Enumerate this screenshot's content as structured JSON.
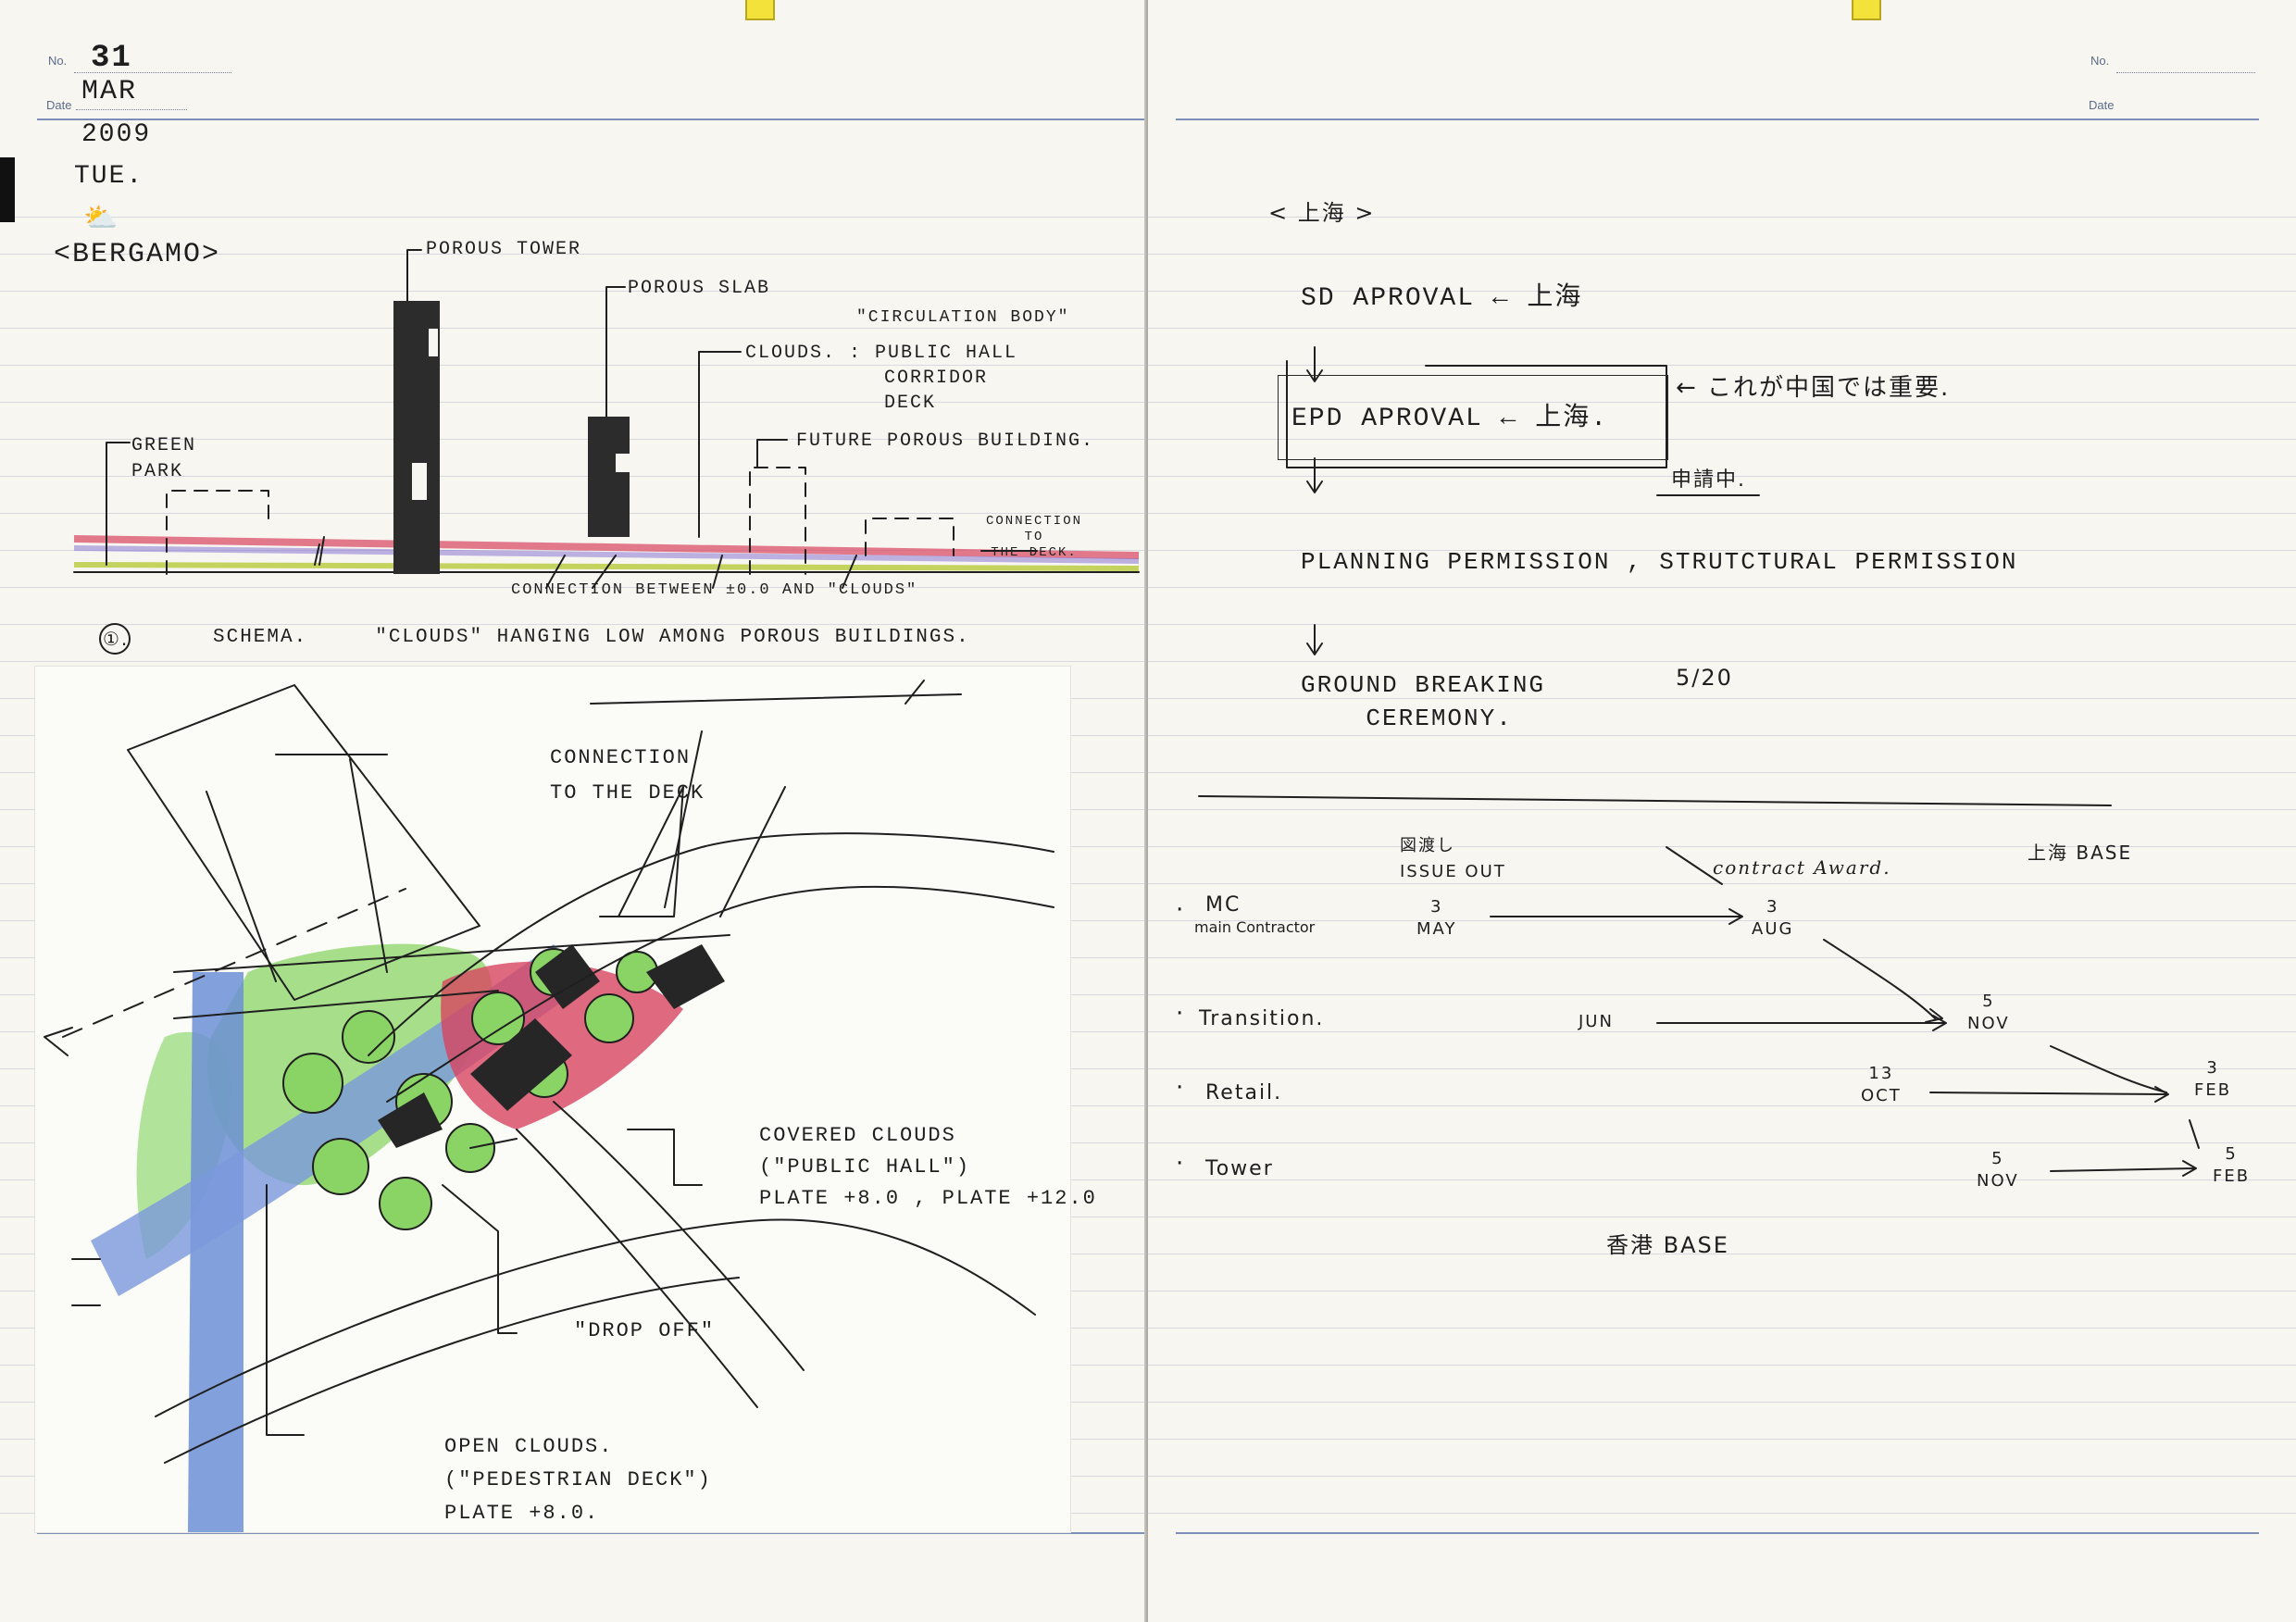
{
  "left_page": {
    "header": {
      "no_label": "No.",
      "date_label": "Date",
      "no_value": "31",
      "date_month": "MAR",
      "date_year": "2009",
      "date_day": "TUE."
    },
    "project_title": "<BERGAMO>",
    "schema": {
      "porous_tower": "POROUS TOWER",
      "porous_slab": "POROUS SLAB",
      "circulation_body": "\"CIRCULATION BODY\"",
      "clouds_label": "CLOUDS. : PUBLIC HALL",
      "clouds_corridor": "CORRIDOR",
      "clouds_deck": "DECK",
      "green_park": "GREEN\nPARK",
      "future_building": "FUTURE POROUS BUILDING.",
      "connection_deck": "CONNECTION\nTO\nTHE DECK.",
      "connection_between": "CONNECTION BETWEEN ±0.0 AND \"CLOUDS\"",
      "caption_number": "①.",
      "caption": "SCHEMA.     \"CLOUDS\" HANGING LOW AMONG POROUS BUILDINGS."
    },
    "plan": {
      "connection_to_deck": "CONNECTION\nTO THE DECK",
      "covered_clouds": "COVERED CLOUDS\n(\"PUBLIC HALL\")\nPLATE +8.0 , PLATE +12.0",
      "drop_off": "\"DROP OFF\"",
      "open_clouds": "OPEN CLOUDS.\n(\"PEDESTRIAN DECK\")\nPLATE +8.0."
    }
  },
  "right_page": {
    "header": {
      "no_label": "No.",
      "date_label": "Date"
    },
    "title": "< 上海 >",
    "sd_approval": "SD APROVAL ← 上海",
    "epd_approval": "EPD APROVAL ← 上海.",
    "note_china": "← これが中国では重要.",
    "under_application": "申請中.",
    "planning": "PLANNING PERMISSION , STRUTCTURAL PERMISSION",
    "ground_breaking": "GROUND BREAKING\n    CEREMONY.",
    "gb_date": "5/20",
    "schedule": {
      "issue_out": "図渡し\nISSUE OUT",
      "contract_award": "contract Award.",
      "shanghai_base": "上海 BASE",
      "hongkong_base": "香港 BASE",
      "rows": [
        {
          "label": "MC",
          "sub": "main Contractor",
          "start": "3\nMAY",
          "end": "3\nAUG"
        },
        {
          "label": "Transition.",
          "sub": "",
          "start": "JUN",
          "end": "5\nNOV"
        },
        {
          "label": "Retail.",
          "sub": "",
          "start": "13\nOCT",
          "end": "3\nFEB"
        },
        {
          "label": "Tower",
          "sub": "",
          "start": "5\nNOV",
          "end": "5\nFEB"
        }
      ]
    }
  },
  "colors": {
    "ink": "#1f1f1f",
    "green": "#7fd05a",
    "blue": "#6c8fd6",
    "red": "#d8455f",
    "paper": "#f7f6f1",
    "rule": "#7c8fb8"
  }
}
